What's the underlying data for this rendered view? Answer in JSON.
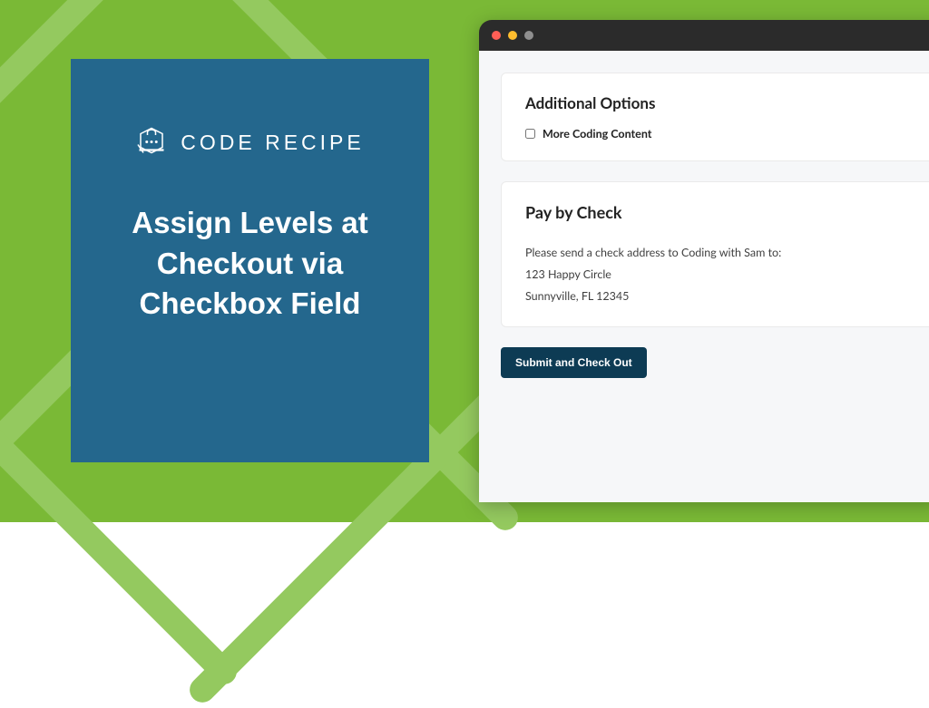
{
  "brand": {
    "name": "CODE RECIPE"
  },
  "headline": "Assign Levels at Checkout via Checkbox Field",
  "checkout": {
    "options": {
      "title": "Additional Options",
      "checkbox_label": "More Coding Content"
    },
    "payment": {
      "title": "Pay by Check",
      "instructions": "Please send a check address to Coding with Sam to:",
      "address_line1": "123 Happy Circle",
      "address_line2": "Sunnyville, FL 12345"
    },
    "submit_label": "Submit and Check Out"
  },
  "colors": {
    "background": "#7ab936",
    "card": "#24678d",
    "submit": "#0d3b54"
  }
}
